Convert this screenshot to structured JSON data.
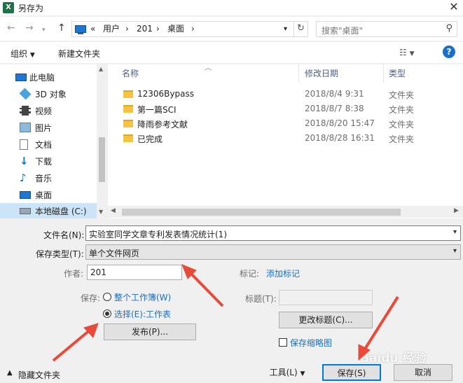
{
  "window": {
    "title": "另存为",
    "app_icon": "X"
  },
  "nav": {
    "back": "←",
    "forward": "→",
    "up": "↑"
  },
  "address": {
    "crumbs": [
      "«",
      "用户",
      "201",
      "桌面"
    ]
  },
  "search": {
    "placeholder": "搜索\"桌面\""
  },
  "toolbar": {
    "organize": "组织",
    "new_folder": "新建文件夹"
  },
  "sidebar": {
    "items": [
      {
        "label": "此电脑"
      },
      {
        "label": "3D 对象"
      },
      {
        "label": "视频"
      },
      {
        "label": "图片"
      },
      {
        "label": "文档"
      },
      {
        "label": "下载"
      },
      {
        "label": "音乐"
      },
      {
        "label": "桌面"
      },
      {
        "label": "本地磁盘 (C:)"
      }
    ]
  },
  "files": {
    "columns": [
      "名称",
      "修改日期",
      "类型"
    ],
    "rows": [
      {
        "name": "12306Bypass",
        "date": "2018/8/4 9:31",
        "type": "文件夹"
      },
      {
        "name": "第一篇SCI",
        "date": "2018/8/7 8:38",
        "type": "文件夹"
      },
      {
        "name": "降雨参考文献",
        "date": "2018/8/20 15:47",
        "type": "文件夹"
      },
      {
        "name": "已完成",
        "date": "2018/8/28 16:31",
        "type": "文件夹"
      }
    ]
  },
  "form": {
    "filename_label": "文件名(N):",
    "filename_value": "实验室同学文章专利发表情况统计(1)",
    "filetype_label": "保存类型(T):",
    "filetype_value": "单个文件网页",
    "author_label": "作者:",
    "author_value": "201",
    "tags_label": "标记:",
    "tags_link": "添加标记",
    "save_label": "保存:",
    "radio_workbook": "整个工作簿(W)",
    "radio_selection": "选择(E):工作表",
    "publish_button": "发布(P)...",
    "title_label": "标题(T):",
    "change_title_button": "更改标题(C)...",
    "thumbnail_label": "保存缩略图"
  },
  "footer": {
    "hide_folders": "隐藏文件夹",
    "tools": "工具(L)",
    "save_button": "保存(S)",
    "cancel_button": "取消"
  },
  "watermark": "Baidu 经验",
  "colors": {
    "accent": "#1a6fbf",
    "arrow": "#e84b3a",
    "selection": "#cce4f7"
  }
}
